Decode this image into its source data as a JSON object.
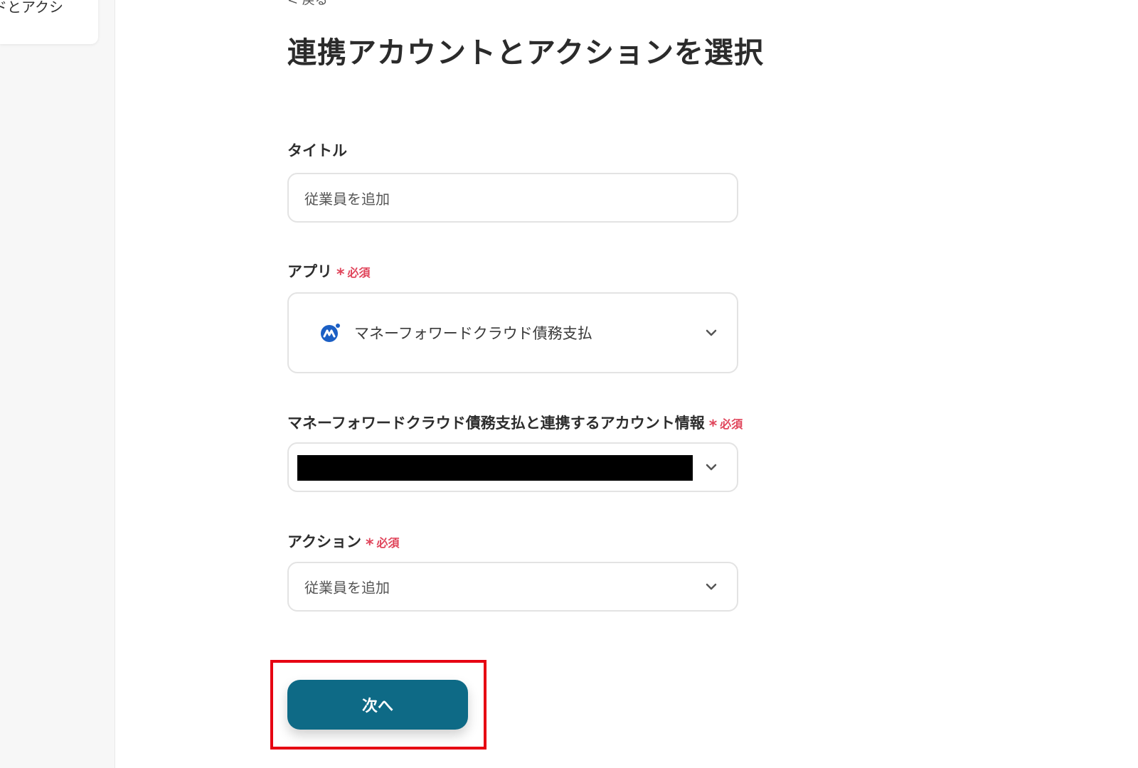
{
  "sidebar": {
    "card_text": "ドとアクシ"
  },
  "header": {
    "back_label": "< 戻る",
    "title": "連携アカウントとアクションを選択"
  },
  "form": {
    "required_label": "必須",
    "title_field": {
      "label": "タイトル",
      "value": "従業員を追加"
    },
    "app_field": {
      "label": "アプリ",
      "value": "マネーフォワードクラウド債務支払",
      "icon": "moneyforward-logo-icon"
    },
    "account_field": {
      "label": "マネーフォワードクラウド債務支払と連携するアカウント情報",
      "value": ""
    },
    "action_field": {
      "label": "アクション",
      "value": "従業員を追加"
    },
    "next_button": "次へ"
  },
  "colors": {
    "primary_button": "#0e6a86",
    "required": "#e0455b",
    "highlight_frame": "#e60012",
    "logo_blue": "#1b5fc4"
  }
}
